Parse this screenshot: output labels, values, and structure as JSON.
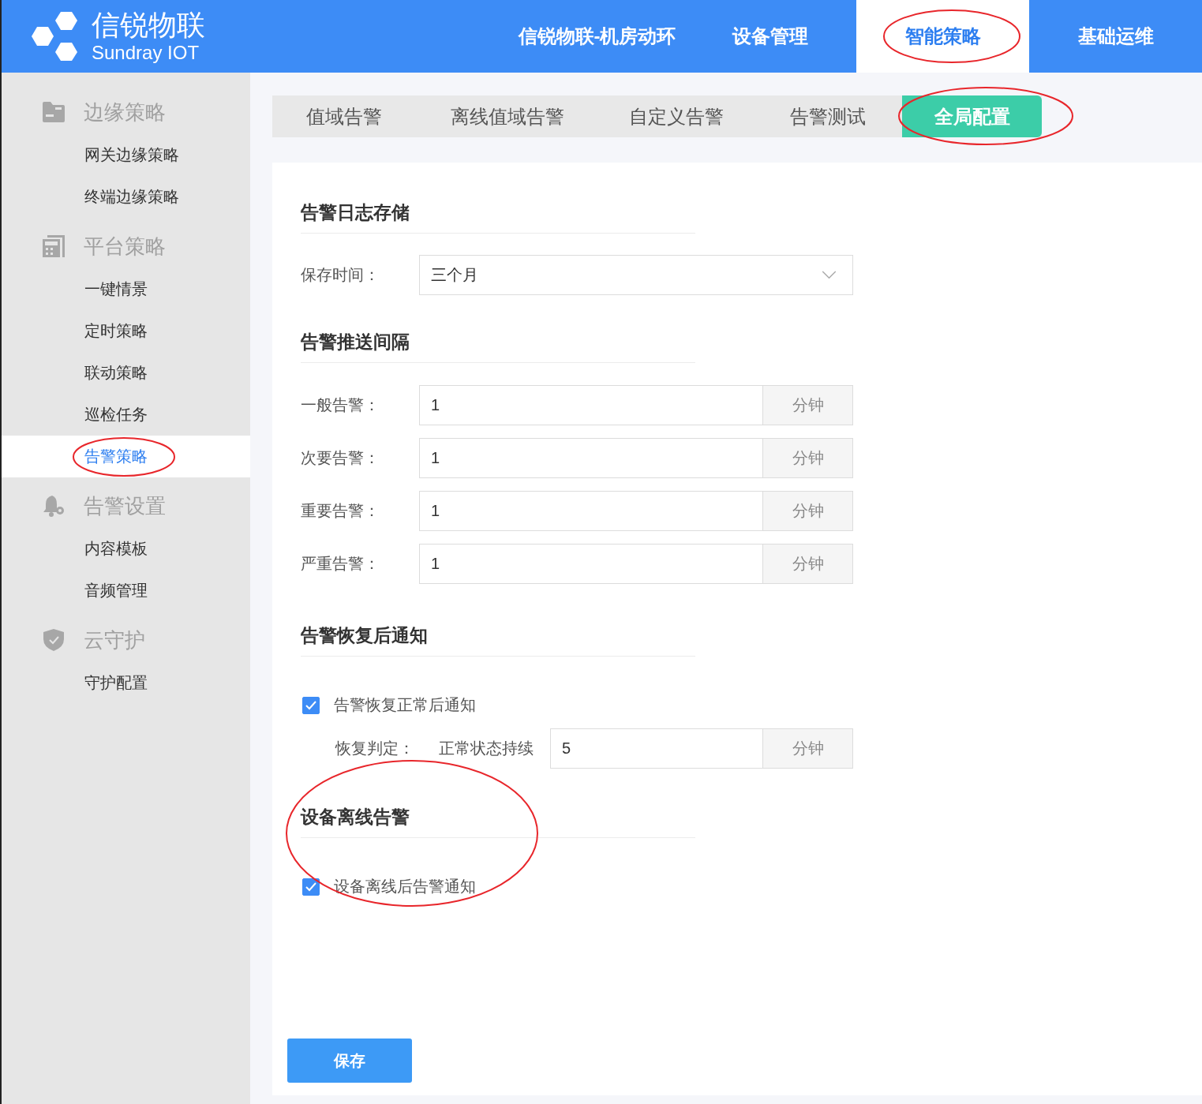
{
  "header": {
    "logo_title": "信锐物联",
    "logo_subtitle": "Sundray IOT",
    "nav": [
      {
        "label": "信锐物联-机房动环",
        "selected": false,
        "circled": false
      },
      {
        "label": "设备管理",
        "selected": false,
        "circled": false
      },
      {
        "label": "智能策略",
        "selected": true,
        "circled": true
      },
      {
        "label": "基础运维",
        "selected": false,
        "circled": false
      }
    ]
  },
  "sidebar": {
    "groups": [
      {
        "title": "边缘策略",
        "items": [
          {
            "label": "网关边缘策略",
            "selected": false,
            "circled": false
          },
          {
            "label": "终端边缘策略",
            "selected": false,
            "circled": false
          }
        ]
      },
      {
        "title": "平台策略",
        "items": [
          {
            "label": "一键情景",
            "selected": false,
            "circled": false
          },
          {
            "label": "定时策略",
            "selected": false,
            "circled": false
          },
          {
            "label": "联动策略",
            "selected": false,
            "circled": false
          },
          {
            "label": "巡检任务",
            "selected": false,
            "circled": false
          },
          {
            "label": "告警策略",
            "selected": true,
            "circled": true
          }
        ]
      },
      {
        "title": "告警设置",
        "items": [
          {
            "label": "内容模板",
            "selected": false,
            "circled": false
          },
          {
            "label": "音频管理",
            "selected": false,
            "circled": false
          }
        ]
      },
      {
        "title": "云守护",
        "items": [
          {
            "label": "守护配置",
            "selected": false,
            "circled": false
          }
        ]
      }
    ]
  },
  "tabs": [
    {
      "label": "值域告警",
      "selected": false,
      "circled": false
    },
    {
      "label": "离线值域告警",
      "selected": false,
      "circled": false
    },
    {
      "label": "自定义告警",
      "selected": false,
      "circled": false
    },
    {
      "label": "告警测试",
      "selected": false,
      "circled": false
    },
    {
      "label": "全局配置",
      "selected": true,
      "circled": true
    }
  ],
  "sections": [
    {
      "title": "告警日志存储",
      "circled": false,
      "rows": [
        {
          "kind": "select",
          "label": "保存时间：",
          "value": "三个月"
        }
      ]
    },
    {
      "title": "告警推送间隔",
      "circled": false,
      "rows": [
        {
          "kind": "number",
          "label": "一般告警：",
          "value": "1",
          "unit": "分钟"
        },
        {
          "kind": "number",
          "label": "次要告警：",
          "value": "1",
          "unit": "分钟"
        },
        {
          "kind": "number",
          "label": "重要告警：",
          "value": "1",
          "unit": "分钟"
        },
        {
          "kind": "number",
          "label": "严重告警：",
          "value": "1",
          "unit": "分钟"
        }
      ]
    },
    {
      "title": "告警恢复后通知",
      "circled": false,
      "rows": [
        {
          "kind": "checkbox",
          "label": "告警恢复正常后通知",
          "checked": true
        },
        {
          "kind": "duration",
          "label": "恢复判定：",
          "prefix": "正常状态持续",
          "value": "5",
          "unit": "分钟"
        }
      ]
    },
    {
      "title": "设备离线告警",
      "circled": true,
      "rows": [
        {
          "kind": "checkbox",
          "label": "设备离线后告警通知",
          "checked": true
        }
      ]
    }
  ],
  "save_button": "保存"
}
